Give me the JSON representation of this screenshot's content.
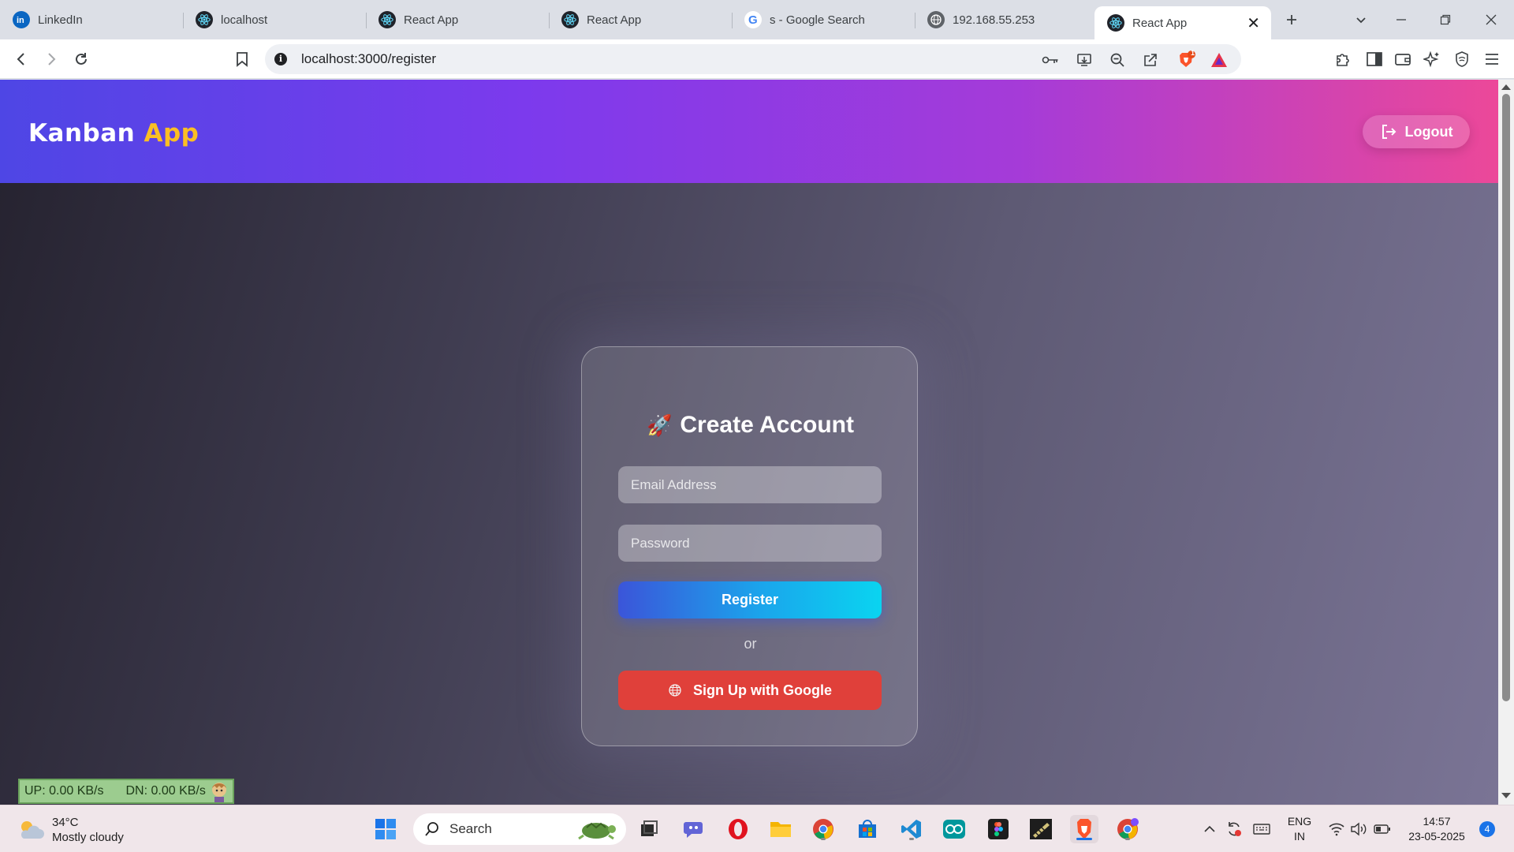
{
  "browser": {
    "tabs": [
      {
        "title": "LinkedIn",
        "icon": "linkedin-icon"
      },
      {
        "title": "localhost",
        "icon": "react-icon"
      },
      {
        "title": "React App",
        "icon": "react-icon"
      },
      {
        "title": "React App",
        "icon": "react-icon"
      },
      {
        "title": "s - Google Search",
        "icon": "google-icon"
      },
      {
        "title": "192.168.55.253",
        "icon": "globe-icon"
      },
      {
        "title": "React App",
        "icon": "react-icon",
        "active": true
      }
    ],
    "url": "localhost:3000/register",
    "brave_shield_badge": "1"
  },
  "app": {
    "brand_main": "Kanban",
    "brand_accent": "App",
    "logout_label": "Logout",
    "form": {
      "icon": "🚀",
      "title": "Create Account",
      "email_placeholder": "Email Address",
      "password_placeholder": "Password",
      "register_label": "Register",
      "or_label": "or",
      "google_label": "Sign Up with Google"
    }
  },
  "netmeter": {
    "up": "UP: 0.00 KB/s",
    "dn": "DN: 0.00 KB/s"
  },
  "taskbar": {
    "weather_temp": "34°C",
    "weather_desc": "Mostly cloudy",
    "search_label": "Search",
    "lang_top": "ENG",
    "lang_bottom": "IN",
    "time": "14:57",
    "date": "23-05-2025",
    "notification_count": "4"
  },
  "colors": {
    "header_start": "#4e46e5",
    "header_end": "#ec4899",
    "brand_accent": "#fbbf24",
    "register_start": "#3b55d9",
    "register_end": "#0ad4f0",
    "google_button": "#e0403a"
  }
}
